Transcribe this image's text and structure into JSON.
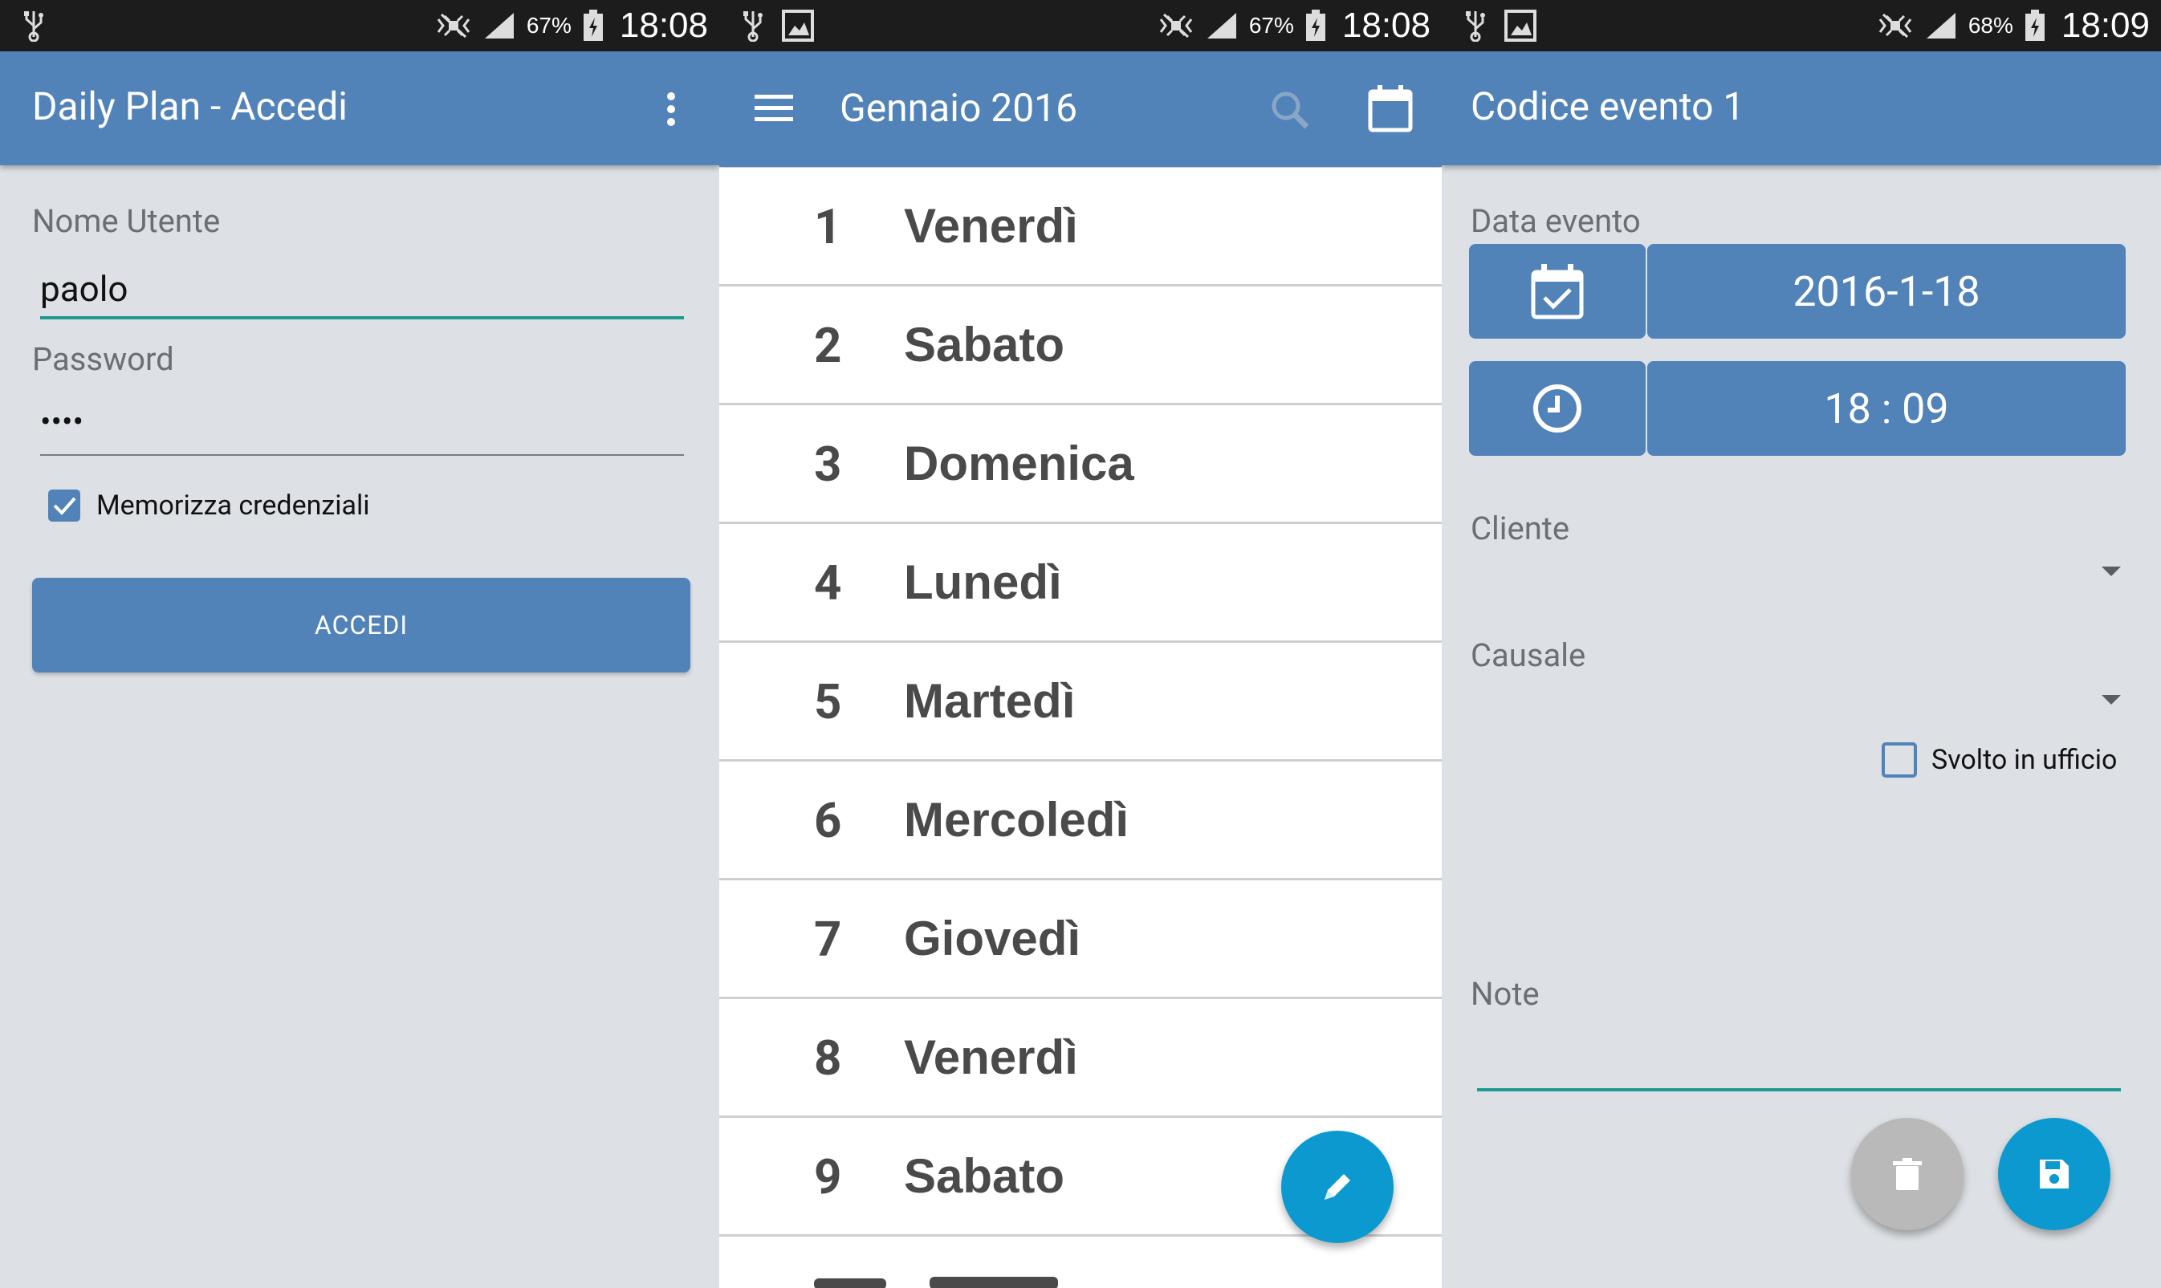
{
  "screens": {
    "login": {
      "status": {
        "battery": "67%",
        "time": "18:08"
      },
      "title": "Daily Plan - Accedi",
      "username_label": "Nome Utente",
      "username_value": "paolo",
      "password_label": "Password",
      "password_value": "••••",
      "remember_label": "Memorizza credenziali",
      "remember_checked": true,
      "login_button": "ACCEDI"
    },
    "calendar": {
      "status": {
        "battery": "67%",
        "time": "18:08"
      },
      "title": "Gennaio 2016",
      "days": [
        {
          "num": "1",
          "name": "Venerdì"
        },
        {
          "num": "2",
          "name": "Sabato"
        },
        {
          "num": "3",
          "name": "Domenica"
        },
        {
          "num": "4",
          "name": "Lunedì"
        },
        {
          "num": "5",
          "name": "Martedì"
        },
        {
          "num": "6",
          "name": "Mercoledì"
        },
        {
          "num": "7",
          "name": "Giovedì"
        },
        {
          "num": "8",
          "name": "Venerdì"
        },
        {
          "num": "9",
          "name": "Sabato"
        }
      ]
    },
    "event": {
      "status": {
        "battery": "68%",
        "time": "18:09"
      },
      "title": "Codice evento 1",
      "date_label": "Data evento",
      "date_value": "2016-1-18",
      "time_value": "18 : 09",
      "client_label": "Cliente",
      "reason_label": "Causale",
      "office_label": "Svolto in ufficio",
      "office_checked": false,
      "notes_label": "Note"
    }
  },
  "colors": {
    "primary": "#5183b8",
    "accent_fab": "#0b99cf",
    "delete_fab": "#b9b9b9",
    "input_active": "#1e9a8e",
    "background": "#dde0e4",
    "statusbar": "#1c1c1c"
  },
  "icons": [
    "usb-icon",
    "gallery-icon",
    "mute-icon",
    "signal-icon",
    "battery-charging-icon",
    "overflow-menu-icon",
    "hamburger-menu-icon",
    "search-icon",
    "calendar-icon",
    "calendar-check-icon",
    "clock-icon",
    "pencil-icon",
    "trash-icon",
    "floppy-save-icon",
    "chevron-down-icon"
  ]
}
